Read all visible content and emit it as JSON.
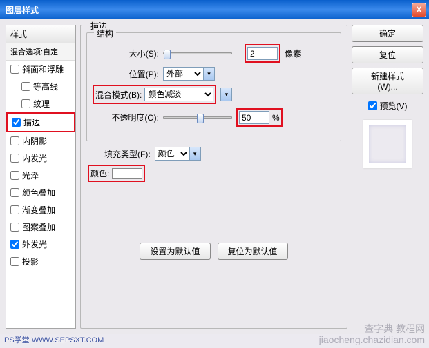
{
  "window": {
    "title": "图层样式",
    "close": "X"
  },
  "sidebar": {
    "header": "样式",
    "sub": "混合选项:自定",
    "items": [
      {
        "label": "斜面和浮雕",
        "checked": false,
        "indent": false
      },
      {
        "label": "等高线",
        "checked": false,
        "indent": true
      },
      {
        "label": "纹理",
        "checked": false,
        "indent": true
      },
      {
        "label": "描边",
        "checked": true,
        "indent": false,
        "hl": true
      },
      {
        "label": "内阴影",
        "checked": false,
        "indent": false
      },
      {
        "label": "内发光",
        "checked": false,
        "indent": false
      },
      {
        "label": "光泽",
        "checked": false,
        "indent": false
      },
      {
        "label": "颜色叠加",
        "checked": false,
        "indent": false
      },
      {
        "label": "渐变叠加",
        "checked": false,
        "indent": false
      },
      {
        "label": "图案叠加",
        "checked": false,
        "indent": false
      },
      {
        "label": "外发光",
        "checked": true,
        "indent": false
      },
      {
        "label": "投影",
        "checked": false,
        "indent": false
      }
    ]
  },
  "main": {
    "panel_title": "描边",
    "structure_title": "结构",
    "size_label": "大小(S):",
    "size_value": "2",
    "size_unit": "像素",
    "position_label": "位置(P):",
    "position_value": "外部",
    "blend_label": "混合模式(B):",
    "blend_value": "颜色减淡",
    "opacity_label": "不透明度(O):",
    "opacity_value": "50",
    "opacity_unit": "%",
    "fill_label": "填充类型(F):",
    "fill_value": "颜色",
    "color_label": "颜色:",
    "color_value": "#ffffff",
    "btn_default": "设置为默认值",
    "btn_reset": "复位为默认值"
  },
  "right": {
    "ok": "确定",
    "reset": "复位",
    "newstyle": "新建样式(W)...",
    "preview": "预览(V)"
  },
  "watermark": {
    "left": "PS学堂  WWW.SEPSXT.COM",
    "right": "查字典 教程网\njiaocheng.chazidian.com"
  }
}
